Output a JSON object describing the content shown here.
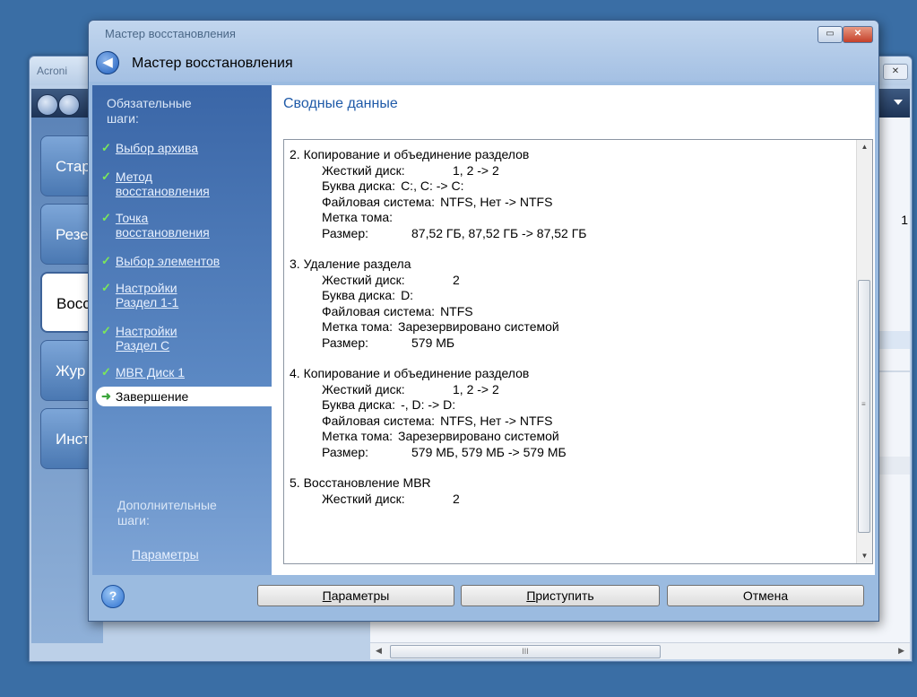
{
  "background_window": {
    "title": "Acroni",
    "tiles": [
      "Стар",
      "Резе",
      "Восс",
      "Жур",
      "Инст"
    ],
    "right_digit": "1",
    "hscroll_grip": "III"
  },
  "dialog": {
    "caption": "Мастер восстановления",
    "header_title": "Мастер восстановления",
    "restore_glyph": "▭",
    "close_glyph": "✕",
    "back_glyph": "◀"
  },
  "steps": {
    "heading_line1": "Обязательные",
    "heading_line2": "шаги:",
    "items": [
      {
        "line1": "Выбор архива",
        "line2": ""
      },
      {
        "line1": "Метод",
        "line2": "восстановления"
      },
      {
        "line1": "Точка",
        "line2": "восстановления"
      },
      {
        "line1": "Выбор элементов",
        "line2": ""
      },
      {
        "line1": "Настройки",
        "line2": "Раздел 1-1"
      },
      {
        "line1": "Настройки",
        "line2": "Раздел C"
      },
      {
        "line1": "MBR Диск 1",
        "line2": ""
      }
    ],
    "current": "Завершение",
    "extra_heading_line1": "Дополнительные",
    "extra_heading_line2": "шаги:",
    "extra_link": "Параметры"
  },
  "content": {
    "title": "Сводные данные",
    "sections": [
      {
        "header": "2. Копирование и объединение разделов",
        "rows": [
          {
            "key": "Жесткий диск:",
            "value": "1, 2 -> 2"
          },
          {
            "key": "Буква диска:",
            "value": "C:, C: -> C:"
          },
          {
            "key": "Файловая система:",
            "value": "NTFS, Нет -> NTFS"
          },
          {
            "key": "Метка тома:",
            "value": ""
          },
          {
            "key": "Размер:",
            "value": "87,52 ГБ, 87,52 ГБ -> 87,52 ГБ"
          }
        ]
      },
      {
        "header": "3. Удаление раздела",
        "rows": [
          {
            "key": "Жесткий диск:",
            "value": "2"
          },
          {
            "key": "Буква диска:",
            "value": "D:"
          },
          {
            "key": "Файловая система:",
            "value": "NTFS"
          },
          {
            "key": "Метка тома:",
            "value": "Зарезервировано системой"
          },
          {
            "key": "Размер:",
            "value": "579 МБ"
          }
        ]
      },
      {
        "header": "4. Копирование и объединение разделов",
        "rows": [
          {
            "key": "Жесткий диск:",
            "value": "1, 2 -> 2"
          },
          {
            "key": "Буква диска:",
            "value": "-, D: -> D:"
          },
          {
            "key": "Файловая система:",
            "value": "NTFS, Нет -> NTFS"
          },
          {
            "key": "Метка тома:",
            "value": "Зарезервировано системой"
          },
          {
            "key": "Размер:",
            "value": "579 МБ, 579 МБ -> 579 МБ"
          }
        ]
      },
      {
        "header": "5. Восстановление MBR",
        "rows": [
          {
            "key": "Жесткий диск:",
            "value": "2"
          }
        ]
      }
    ]
  },
  "footer": {
    "help_glyph": "?",
    "params_pre": "",
    "params_mnemonic": "П",
    "params_post": "араметры",
    "proceed_pre": "",
    "proceed_mnemonic": "П",
    "proceed_post": "риступить",
    "cancel": "Отмена"
  }
}
